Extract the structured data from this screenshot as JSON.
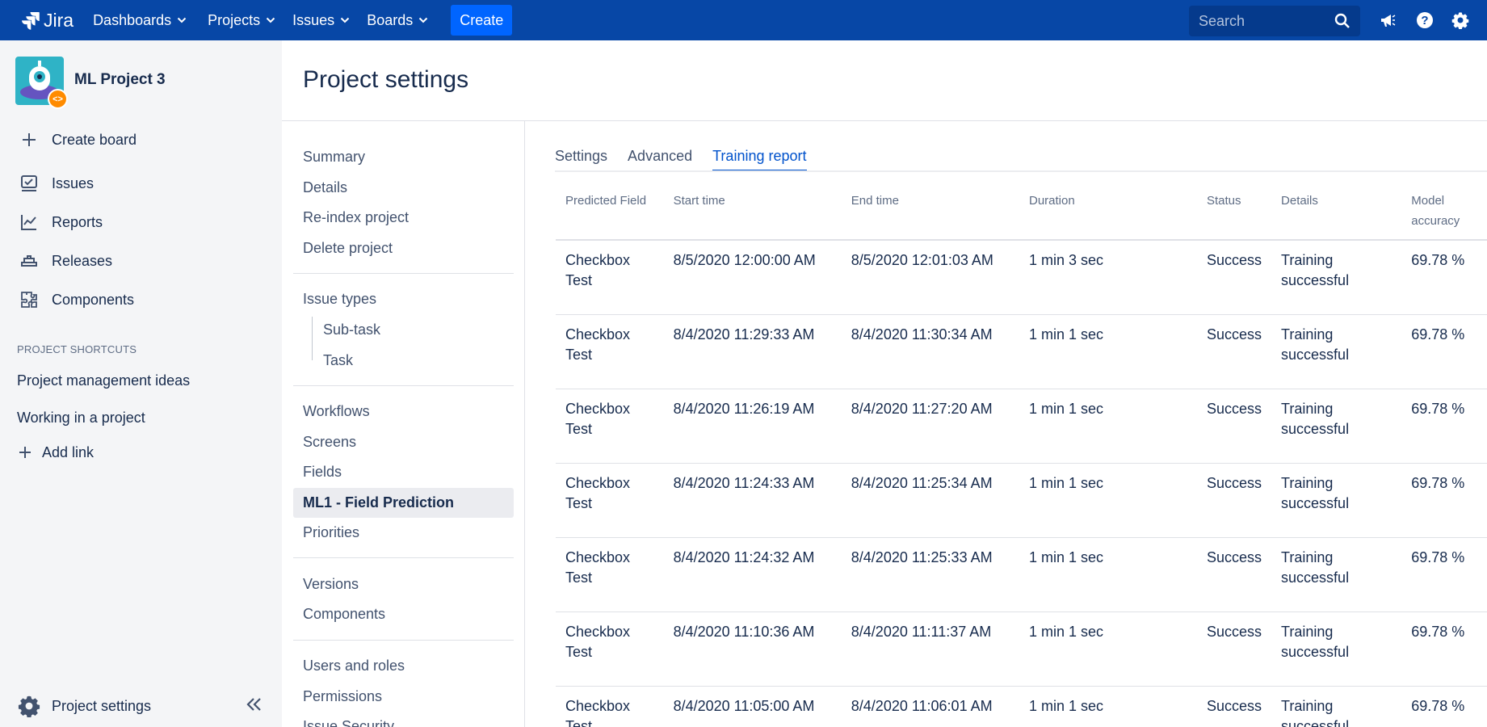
{
  "topnav": {
    "brand": "Jira",
    "items": [
      {
        "label": "Dashboards"
      },
      {
        "label": "Projects"
      },
      {
        "label": "Issues"
      },
      {
        "label": "Boards"
      }
    ],
    "create_label": "Create",
    "search_placeholder": "Search"
  },
  "sidebar": {
    "project_name": "ML Project 3",
    "items": [
      {
        "label": "Create board",
        "icon": "plus-icon"
      },
      {
        "label": "Issues",
        "icon": "issues-icon"
      },
      {
        "label": "Reports",
        "icon": "reports-icon"
      },
      {
        "label": "Releases",
        "icon": "releases-icon"
      },
      {
        "label": "Components",
        "icon": "components-icon"
      }
    ],
    "shortcuts_heading": "PROJECT SHORTCUTS",
    "shortcuts": [
      "Project management ideas",
      "Working in a project"
    ],
    "add_link_label": "Add link",
    "settings_label": "Project settings"
  },
  "page": {
    "title": "Project settings"
  },
  "settings_menu": {
    "group1": [
      "Summary",
      "Details",
      "Re-index project",
      "Delete project"
    ],
    "issue_types_label": "Issue types",
    "issue_types": [
      "Sub-task",
      "Task"
    ],
    "group3": [
      "Workflows",
      "Screens",
      "Fields",
      "ML1 - Field Prediction",
      "Priorities"
    ],
    "active_item": "ML1 - Field Prediction",
    "group4": [
      "Versions",
      "Components"
    ],
    "group5": [
      "Users and roles",
      "Permissions",
      "Issue Security"
    ]
  },
  "tabs": [
    {
      "label": "Settings",
      "active": false
    },
    {
      "label": "Advanced",
      "active": false
    },
    {
      "label": "Training report",
      "active": true
    }
  ],
  "report_table": {
    "headers": [
      "Predicted Field",
      "Start time",
      "End time",
      "Duration",
      "Status",
      "Details",
      "Model accuracy"
    ],
    "rows": [
      [
        "Checkbox Test",
        "8/5/2020 12:00:00 AM",
        "8/5/2020 12:01:03 AM",
        "1 min 3 sec",
        "Success",
        "Training successful",
        "69.78 %"
      ],
      [
        "Checkbox Test",
        "8/4/2020 11:29:33 AM",
        "8/4/2020 11:30:34 AM",
        "1 min 1 sec",
        "Success",
        "Training successful",
        "69.78 %"
      ],
      [
        "Checkbox Test",
        "8/4/2020 11:26:19 AM",
        "8/4/2020 11:27:20 AM",
        "1 min 1 sec",
        "Success",
        "Training successful",
        "69.78 %"
      ],
      [
        "Checkbox Test",
        "8/4/2020 11:24:33 AM",
        "8/4/2020 11:25:34 AM",
        "1 min 1 sec",
        "Success",
        "Training successful",
        "69.78 %"
      ],
      [
        "Checkbox Test",
        "8/4/2020 11:24:32 AM",
        "8/4/2020 11:25:33 AM",
        "1 min 1 sec",
        "Success",
        "Training successful",
        "69.78 %"
      ],
      [
        "Checkbox Test",
        "8/4/2020 11:10:36 AM",
        "8/4/2020 11:11:37 AM",
        "1 min 1 sec",
        "Success",
        "Training successful",
        "69.78 %"
      ],
      [
        "Checkbox Test",
        "8/4/2020 11:05:00 AM",
        "8/4/2020 11:06:01 AM",
        "1 min 1 sec",
        "Success",
        "Training successful",
        "69.78 %"
      ]
    ]
  },
  "colors": {
    "nav_bg": "#0747a6",
    "create_bg": "#0065ff",
    "sidebar_bg": "#f4f5f7",
    "active_tab": "#0052cc",
    "badge": "#ff8b00"
  }
}
